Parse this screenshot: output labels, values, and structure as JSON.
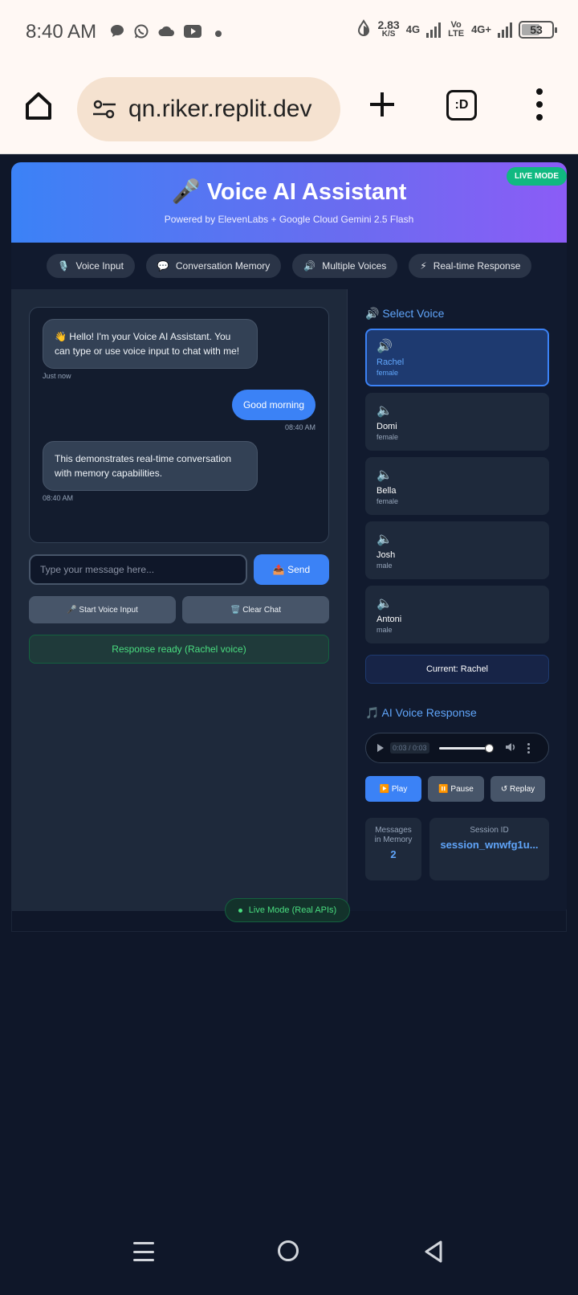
{
  "status": {
    "time": "8:40 AM",
    "net_speed": "2.83",
    "net_unit": "K/S",
    "network_4g": "4G",
    "volte": "Vo LTE",
    "network_4g_plus": "4G+",
    "battery": "53"
  },
  "browser": {
    "url": "qn.riker.replit.dev",
    "tabs_label": ":D"
  },
  "header": {
    "title": "🎤 Voice AI Assistant",
    "subtitle": "Powered by ElevenLabs + Google Cloud Gemini 2.5 Flash",
    "badge": "LIVE MODE"
  },
  "features": [
    {
      "icon": "🎙️",
      "label": "Voice Input"
    },
    {
      "icon": "💬",
      "label": "Conversation Memory"
    },
    {
      "icon": "🔊",
      "label": "Multiple Voices"
    },
    {
      "icon": "⚡",
      "label": "Real-time Response"
    }
  ],
  "chat": {
    "messages": [
      {
        "role": "bot",
        "text": "👋 Hello! I'm your Voice AI Assistant. You can type or use voice input to chat with me!",
        "time": "Just now"
      },
      {
        "role": "user",
        "text": "Good morning",
        "time": "08:40 AM"
      },
      {
        "role": "bot",
        "text": "This demonstrates real-time conversation with memory capabilities.",
        "time": "08:40 AM"
      }
    ],
    "input_placeholder": "Type your message here...",
    "send_label": "📤 Send",
    "voice_input_label": "🎤 Start Voice Input",
    "clear_label": "🗑️ Clear Chat",
    "status": "Response ready (Rachel voice)"
  },
  "voices": {
    "title": "🔊 Select Voice",
    "items": [
      {
        "name": "Rachel",
        "gender": "female",
        "icon": "🔊"
      },
      {
        "name": "Domi",
        "gender": "female",
        "icon": "🔈"
      },
      {
        "name": "Bella",
        "gender": "female",
        "icon": "🔈"
      },
      {
        "name": "Josh",
        "gender": "male",
        "icon": "🔈"
      },
      {
        "name": "Antoni",
        "gender": "male",
        "icon": "🔈"
      }
    ],
    "current": "Current: Rachel"
  },
  "response": {
    "title": "🎵 AI Voice Response",
    "audio_time": "0:03 / 0:03",
    "play_label": "▶️ Play",
    "pause_label": "⏸️ Pause",
    "replay_label": "↺ Replay"
  },
  "stats": {
    "messages_label": "Messages in Memory",
    "messages_value": "2",
    "session_label": "Session ID",
    "session_value": "session_wnwfg1u..."
  },
  "footer": {
    "live_mode": "Live Mode (Real APIs)"
  }
}
